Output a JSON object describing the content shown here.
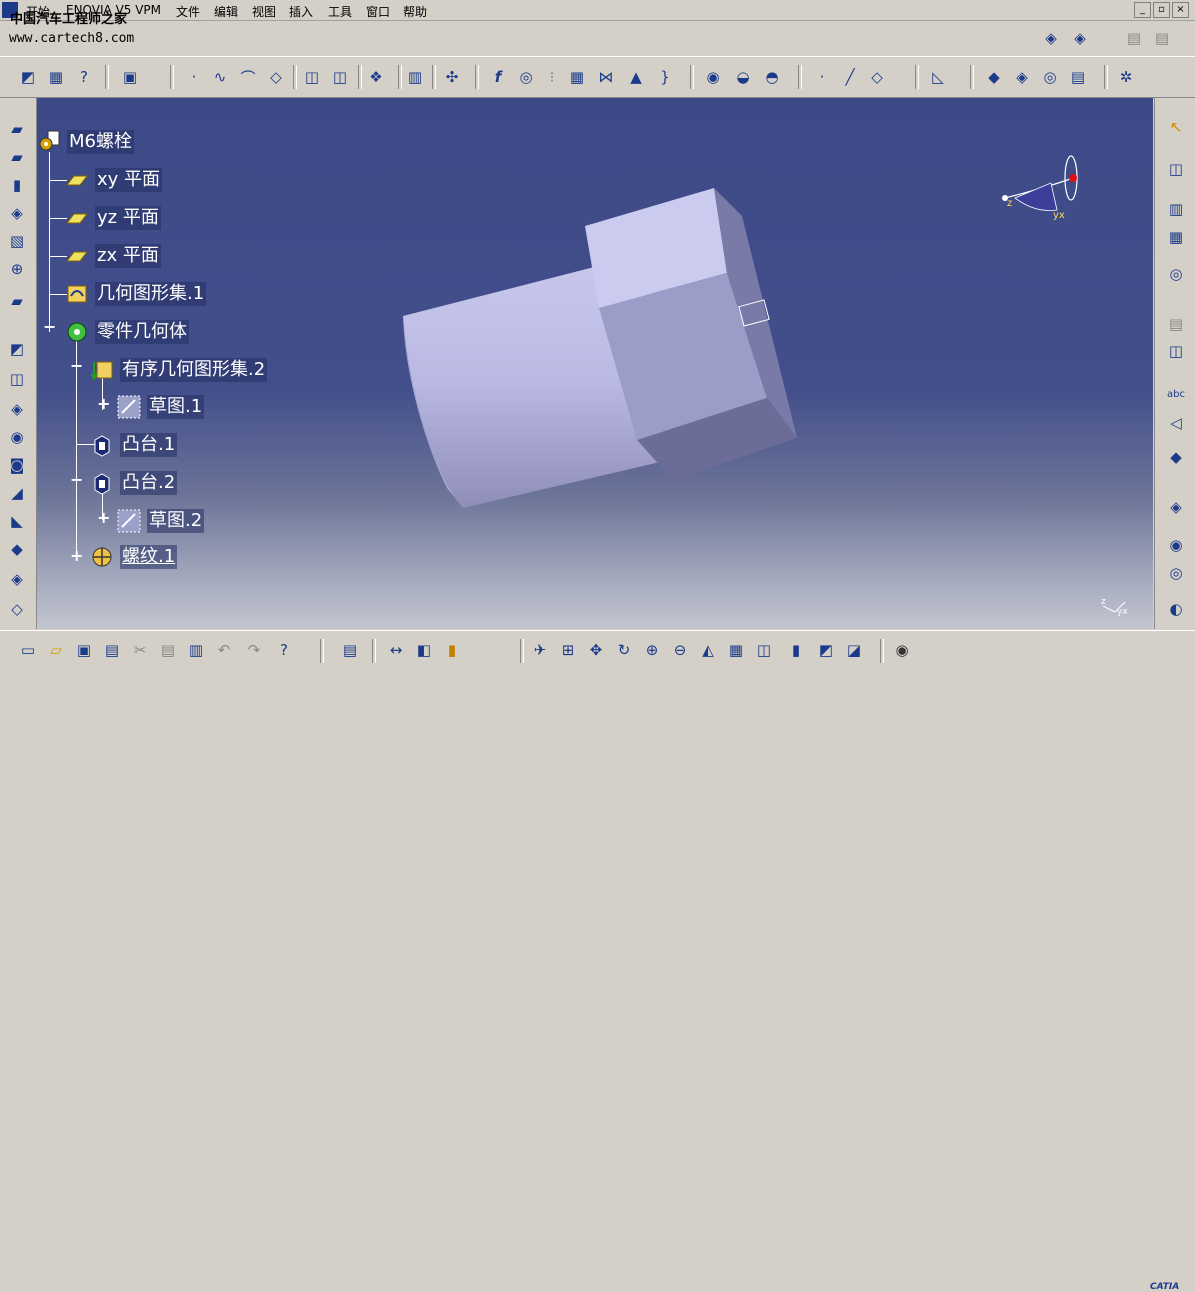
{
  "app": {
    "window_title": "ENOVIA V5 VPM",
    "watermark_cn": "中国汽车工程师之家",
    "watermark_url": "www.cartech8.com",
    "logo": "CATIA"
  },
  "menu": {
    "items": [
      {
        "label": "开始"
      },
      {
        "label": "ENOVIA V5 VPM"
      },
      {
        "label": "文件"
      },
      {
        "label": "编辑"
      },
      {
        "label": "视图"
      },
      {
        "label": "插入"
      },
      {
        "label": "工具"
      },
      {
        "label": "窗口"
      },
      {
        "label": "帮助"
      }
    ]
  },
  "window_controls": {
    "minimize": "_",
    "restore": "▫",
    "close": "×"
  },
  "tree": {
    "root": {
      "label": "M6螺栓"
    },
    "nodes": [
      {
        "label": "xy 平面"
      },
      {
        "label": "yz 平面"
      },
      {
        "label": "zx 平面"
      },
      {
        "label": "几何图形集.1"
      },
      {
        "label": "零件几何体"
      },
      {
        "label": "有序几何图形集.2"
      },
      {
        "label": "草图.1"
      },
      {
        "label": "凸台.1"
      },
      {
        "label": "凸台.2"
      },
      {
        "label": "草图.2"
      },
      {
        "label": "螺纹.1"
      }
    ]
  },
  "compass": {
    "z_label": "z",
    "yx_label": "yx"
  },
  "axis_triad": {
    "z_label": "z",
    "yx_label": "yx"
  },
  "colors": {
    "viewport_top": "#3d4a87",
    "viewport_bottom": "#c3c6d0",
    "part_face": "#c9c9ec",
    "part_side": "#9e9ec6",
    "ui_gray": "#d4d0c8",
    "icon_blue": "#1b3b8a"
  }
}
